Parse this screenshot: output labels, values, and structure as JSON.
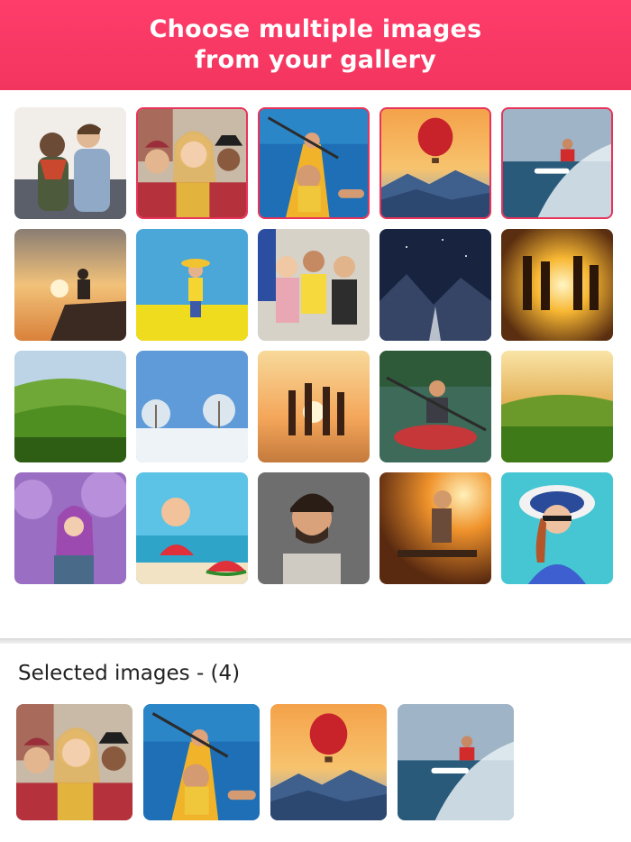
{
  "header": {
    "title_line1": "Choose multiple images",
    "title_line2": "from your gallery"
  },
  "gallery": {
    "items": [
      {
        "name": "couple-with-phone-photo",
        "selected": false
      },
      {
        "name": "three-friends-selfie-photo",
        "selected": true
      },
      {
        "name": "kayak-selfie-photo",
        "selected": true
      },
      {
        "name": "hot-air-balloon-photo",
        "selected": true
      },
      {
        "name": "surfer-wave-photo",
        "selected": true
      },
      {
        "name": "meditation-sunset-photo",
        "selected": false
      },
      {
        "name": "girl-yellow-field-photo",
        "selected": false
      },
      {
        "name": "three-women-street-photo",
        "selected": false
      },
      {
        "name": "night-road-mountains-photo",
        "selected": false
      },
      {
        "name": "friends-sunset-water-photo",
        "selected": false
      },
      {
        "name": "green-hills-photo",
        "selected": false
      },
      {
        "name": "snow-trees-photo",
        "selected": false
      },
      {
        "name": "friends-beach-sunset-photo",
        "selected": false
      },
      {
        "name": "man-kayak-photo",
        "selected": false
      },
      {
        "name": "sunset-meadow-photo",
        "selected": false
      },
      {
        "name": "woman-purple-trees-photo",
        "selected": false
      },
      {
        "name": "kid-watermelon-photo",
        "selected": false
      },
      {
        "name": "man-portrait-photo",
        "selected": false
      },
      {
        "name": "woman-sunset-bench-photo",
        "selected": false
      },
      {
        "name": "woman-sunhat-photo",
        "selected": false
      }
    ]
  },
  "selected_panel": {
    "title": "Selected images - (4)",
    "items": [
      {
        "name": "three-friends-selfie-photo"
      },
      {
        "name": "kayak-selfie-photo"
      },
      {
        "name": "hot-air-balloon-photo"
      },
      {
        "name": "surfer-wave-photo"
      }
    ]
  },
  "colors": {
    "accent": "#f2355f",
    "selected_border": "#e8335a"
  }
}
